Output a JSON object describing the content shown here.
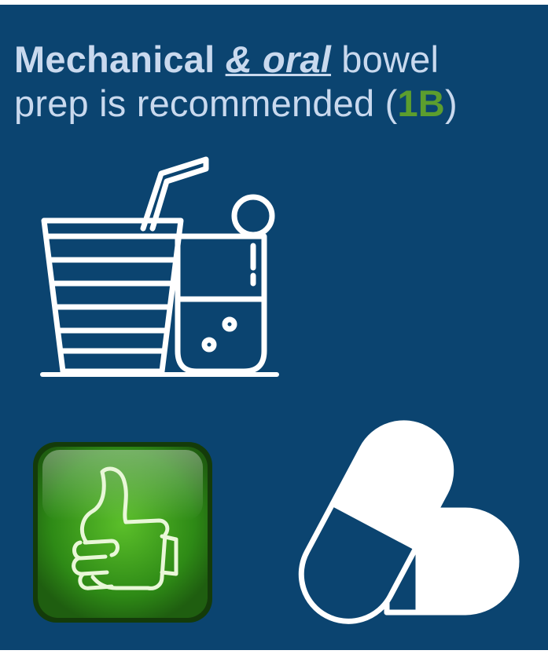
{
  "headline": {
    "part1": "Mechanical ",
    "emphasis": "& oral",
    "part2": " bowel",
    "line2_prefix": "prep is recommended (",
    "grade": "1B",
    "line2_suffix": ")"
  },
  "colors": {
    "background": "#0b4470",
    "text": "#c9d9ee",
    "grade": "#5c9e2e",
    "thumb_button": "#3f9a1f"
  },
  "icons": [
    "drinks-icon",
    "thumbs-up-icon",
    "capsule-pill-icon"
  ]
}
